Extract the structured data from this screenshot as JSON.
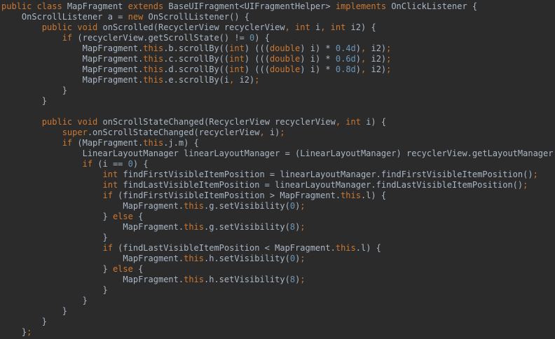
{
  "colors": {
    "background": "#2b2b2b",
    "text": "#a9b7c6",
    "keyword": "#cc7832",
    "field": "#9876aa",
    "number": "#6897bb",
    "method": "#ffc66d"
  },
  "lines": [
    [
      [
        "kw",
        "public class "
      ],
      [
        "plain",
        "MapFragment "
      ],
      [
        "kw",
        "extends "
      ],
      [
        "plain",
        "BaseUIFragment<UIFragmentHelper> "
      ],
      [
        "kw",
        "implements "
      ],
      [
        "plain",
        "OnClickListener {"
      ]
    ],
    [
      [
        "plain",
        "    OnScrollListener a = "
      ],
      [
        "kw",
        "new "
      ],
      [
        "plain",
        "OnScrollListener() {"
      ]
    ],
    [
      [
        "kw",
        "        public void "
      ],
      [
        "plain",
        "onScrolled(RecyclerView recyclerView"
      ],
      [
        "punct",
        ", "
      ],
      [
        "kw",
        "int "
      ],
      [
        "plain",
        "i"
      ],
      [
        "punct",
        ", "
      ],
      [
        "kw",
        "int "
      ],
      [
        "plain",
        "i2) {"
      ]
    ],
    [
      [
        "kw",
        "            if "
      ],
      [
        "plain",
        "(recyclerView.getScrollState() != "
      ],
      [
        "num",
        "0"
      ],
      [
        "plain",
        ") {"
      ]
    ],
    [
      [
        "plain",
        "                MapFragment."
      ],
      [
        "kw",
        "this"
      ],
      [
        "plain",
        ".b.scrollBy(("
      ],
      [
        "kw",
        "int"
      ],
      [
        "plain",
        ") ((("
      ],
      [
        "kw",
        "double"
      ],
      [
        "plain",
        ") i) * "
      ],
      [
        "num",
        "0.4d"
      ],
      [
        "plain",
        ")"
      ],
      [
        "punct",
        ", "
      ],
      [
        "plain",
        "i2)"
      ],
      [
        "punct",
        ";"
      ]
    ],
    [
      [
        "plain",
        "                MapFragment."
      ],
      [
        "kw",
        "this"
      ],
      [
        "plain",
        ".c.scrollBy(("
      ],
      [
        "kw",
        "int"
      ],
      [
        "plain",
        ") ((("
      ],
      [
        "kw",
        "double"
      ],
      [
        "plain",
        ") i) * "
      ],
      [
        "num",
        "0.6d"
      ],
      [
        "plain",
        ")"
      ],
      [
        "punct",
        ", "
      ],
      [
        "plain",
        "i2)"
      ],
      [
        "punct",
        ";"
      ]
    ],
    [
      [
        "plain",
        "                MapFragment."
      ],
      [
        "kw",
        "this"
      ],
      [
        "plain",
        ".d.scrollBy(("
      ],
      [
        "kw",
        "int"
      ],
      [
        "plain",
        ") ((("
      ],
      [
        "kw",
        "double"
      ],
      [
        "plain",
        ") i) * "
      ],
      [
        "num",
        "0.8d"
      ],
      [
        "plain",
        ")"
      ],
      [
        "punct",
        ", "
      ],
      [
        "plain",
        "i2)"
      ],
      [
        "punct",
        ";"
      ]
    ],
    [
      [
        "plain",
        "                MapFragment."
      ],
      [
        "kw",
        "this"
      ],
      [
        "plain",
        ".e.scrollBy(i"
      ],
      [
        "punct",
        ", "
      ],
      [
        "plain",
        "i2)"
      ],
      [
        "punct",
        ";"
      ]
    ],
    [
      [
        "plain",
        "            }"
      ]
    ],
    [
      [
        "plain",
        "        }"
      ]
    ],
    [
      [
        "plain",
        ""
      ]
    ],
    [
      [
        "kw",
        "        public void "
      ],
      [
        "plain",
        "onScrollStateChanged(RecyclerView recyclerView"
      ],
      [
        "punct",
        ", "
      ],
      [
        "kw",
        "int "
      ],
      [
        "plain",
        "i) {"
      ]
    ],
    [
      [
        "kw",
        "            super"
      ],
      [
        "plain",
        ".onScrollStateChanged(recyclerView"
      ],
      [
        "punct",
        ", "
      ],
      [
        "plain",
        "i)"
      ],
      [
        "punct",
        ";"
      ]
    ],
    [
      [
        "kw",
        "            if "
      ],
      [
        "plain",
        "(MapFragment."
      ],
      [
        "kw",
        "this"
      ],
      [
        "plain",
        ".j.m) {"
      ]
    ],
    [
      [
        "plain",
        "                LinearLayoutManager linearLayoutManager = (LinearLayoutManager) recyclerView.getLayoutManager()"
      ],
      [
        "punct",
        ";"
      ]
    ],
    [
      [
        "kw",
        "                if "
      ],
      [
        "plain",
        "(i == "
      ],
      [
        "num",
        "0"
      ],
      [
        "plain",
        ") {"
      ]
    ],
    [
      [
        "kw",
        "                    int "
      ],
      [
        "plain",
        "findFirstVisibleItemPosition = linearLayoutManager.findFirstVisibleItemPosition()"
      ],
      [
        "punct",
        ";"
      ]
    ],
    [
      [
        "kw",
        "                    int "
      ],
      [
        "plain",
        "findLastVisibleItemPosition = linearLayoutManager.findLastVisibleItemPosition()"
      ],
      [
        "punct",
        ";"
      ]
    ],
    [
      [
        "kw",
        "                    if "
      ],
      [
        "plain",
        "(findFirstVisibleItemPosition > MapFragment."
      ],
      [
        "kw",
        "this"
      ],
      [
        "plain",
        ".l) {"
      ]
    ],
    [
      [
        "plain",
        "                        MapFragment."
      ],
      [
        "kw",
        "this"
      ],
      [
        "plain",
        ".g.setVisibility("
      ],
      [
        "num",
        "0"
      ],
      [
        "plain",
        ")"
      ],
      [
        "punct",
        ";"
      ]
    ],
    [
      [
        "plain",
        "                    } "
      ],
      [
        "kw",
        "else "
      ],
      [
        "plain",
        "{"
      ]
    ],
    [
      [
        "plain",
        "                        MapFragment."
      ],
      [
        "kw",
        "this"
      ],
      [
        "plain",
        ".g.setVisibility("
      ],
      [
        "num",
        "8"
      ],
      [
        "plain",
        ")"
      ],
      [
        "punct",
        ";"
      ]
    ],
    [
      [
        "plain",
        "                    }"
      ]
    ],
    [
      [
        "kw",
        "                    if "
      ],
      [
        "plain",
        "(findLastVisibleItemPosition < MapFragment."
      ],
      [
        "kw",
        "this"
      ],
      [
        "plain",
        ".l) {"
      ]
    ],
    [
      [
        "plain",
        "                        MapFragment."
      ],
      [
        "kw",
        "this"
      ],
      [
        "plain",
        ".h.setVisibility("
      ],
      [
        "num",
        "0"
      ],
      [
        "plain",
        ")"
      ],
      [
        "punct",
        ";"
      ]
    ],
    [
      [
        "plain",
        "                    } "
      ],
      [
        "kw",
        "else "
      ],
      [
        "plain",
        "{"
      ]
    ],
    [
      [
        "plain",
        "                        MapFragment."
      ],
      [
        "kw",
        "this"
      ],
      [
        "plain",
        ".h.setVisibility("
      ],
      [
        "num",
        "8"
      ],
      [
        "plain",
        ")"
      ],
      [
        "punct",
        ";"
      ]
    ],
    [
      [
        "plain",
        "                    }"
      ]
    ],
    [
      [
        "plain",
        "                }"
      ]
    ],
    [
      [
        "plain",
        "            }"
      ]
    ],
    [
      [
        "plain",
        "        }"
      ]
    ],
    [
      [
        "plain",
        "    }"
      ],
      [
        "punct",
        ";"
      ]
    ]
  ]
}
